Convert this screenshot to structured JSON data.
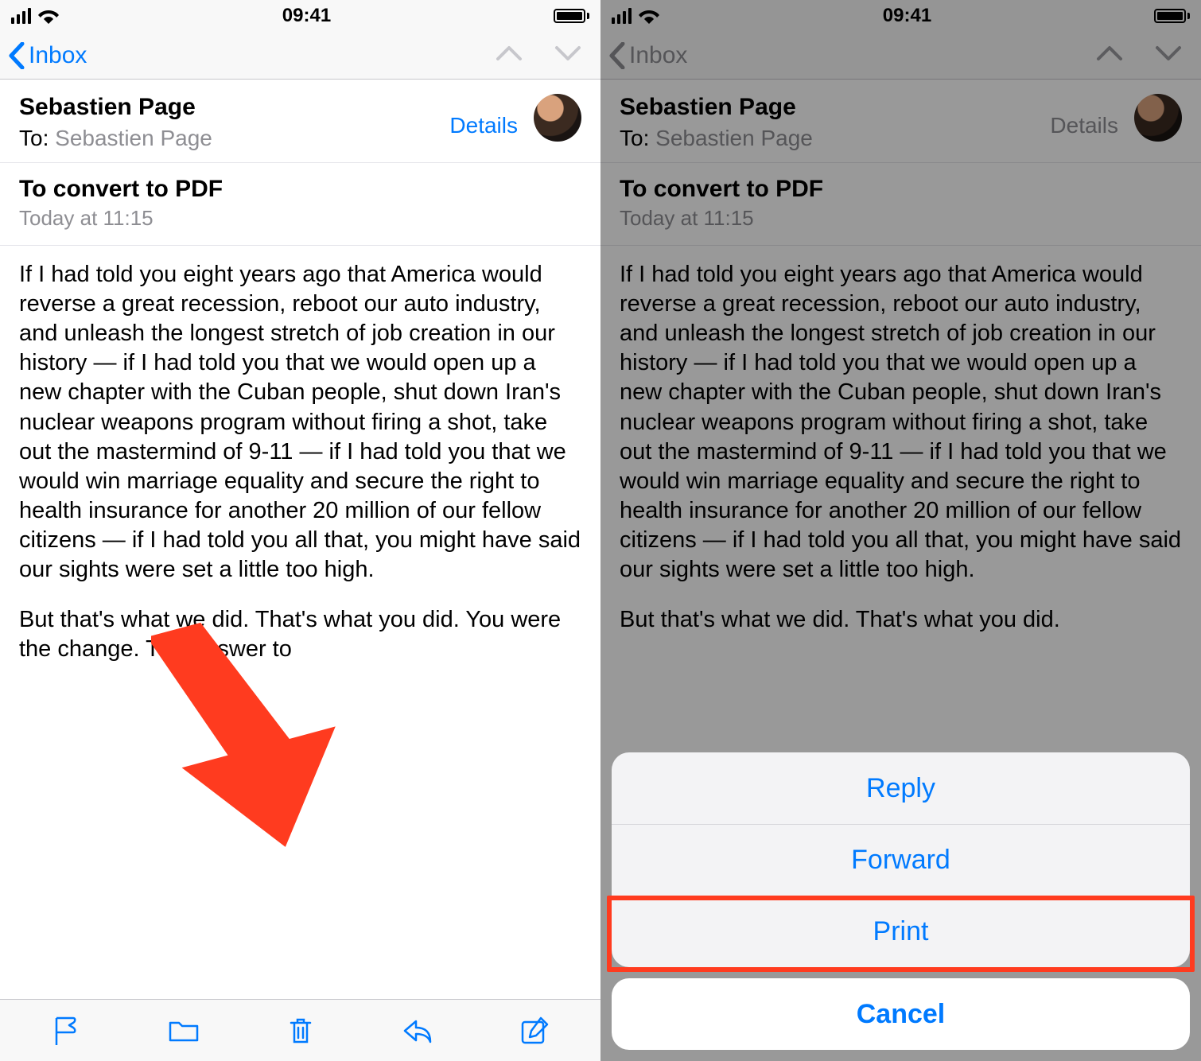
{
  "status": {
    "time": "09:41"
  },
  "nav": {
    "back_label": "Inbox"
  },
  "mail": {
    "from": "Sebastien Page",
    "to_label": "To:",
    "to_name": "Sebastien Page",
    "details": "Details",
    "subject": "To convert to PDF",
    "date": "Today at 11:15",
    "body_p1": "If I had told you eight years ago that America would reverse a great recession, reboot our auto industry, and unleash the longest stretch of job creation in our history — if I had told you that we would open up a new chapter with the Cuban people, shut down Iran's nuclear weapons program without firing a shot, take out the mastermind of 9-11 — if I had told you that we would win marriage equality and secure the right to health insurance for another 20 million of our fellow citizens — if I had told you all that, you might have said our sights were set a little too high.",
    "body_p2": "But that's what we did. That's what you did. You were the change. The answer to",
    "body_p2_short": "But that's what we did. That's what you did."
  },
  "sheet": {
    "reply": "Reply",
    "forward": "Forward",
    "print": "Print",
    "cancel": "Cancel"
  }
}
